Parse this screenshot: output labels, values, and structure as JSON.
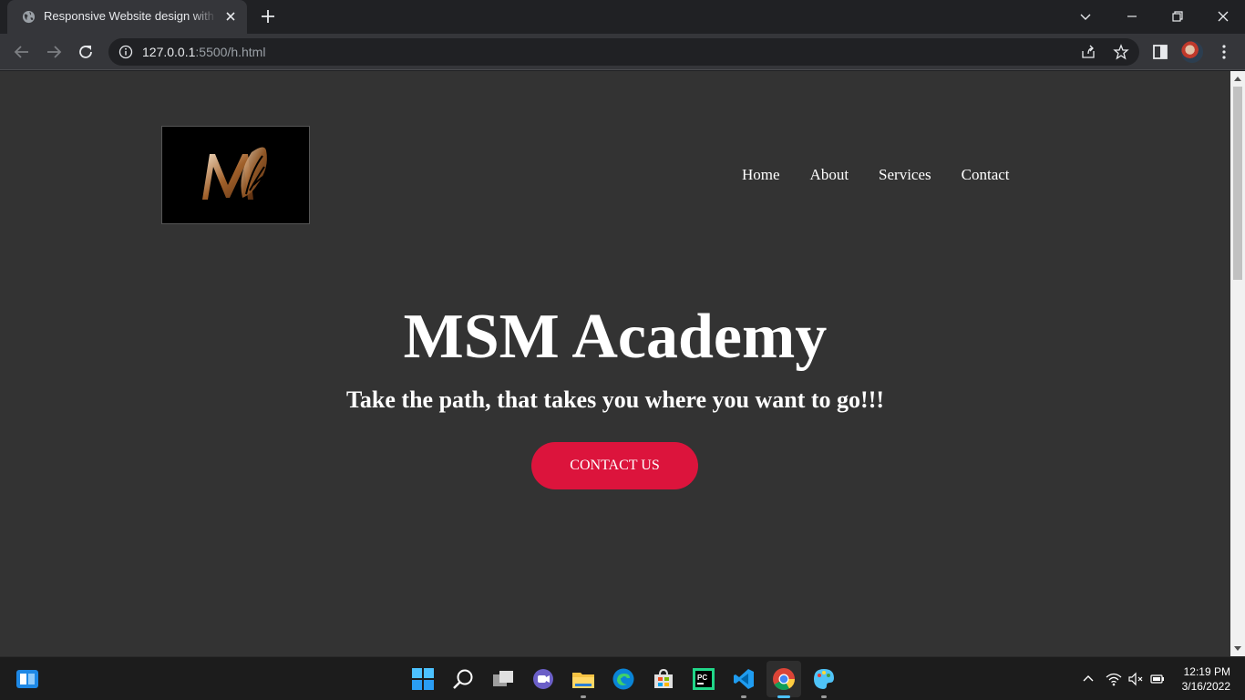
{
  "browser": {
    "tab_title": "Responsive Website design with HTML",
    "url_host": "127.0.0.1",
    "url_rest": ":5500/h.html"
  },
  "site": {
    "nav": [
      "Home",
      "About",
      "Services",
      "Contact"
    ],
    "hero_title": "MSM Academy",
    "hero_subtitle": "Take the path, that takes you where you want to go!!!",
    "cta_label": "CONTACT US",
    "accent_color": "#dc143c",
    "background_color": "#333333"
  },
  "taskbar": {
    "icons": [
      "widgets-icon",
      "start-icon",
      "search-icon",
      "task-view-icon",
      "chat-icon",
      "file-explorer-icon",
      "edge-icon",
      "store-icon",
      "pycharm-icon",
      "vscode-icon",
      "chrome-icon",
      "paint-icon"
    ],
    "time": "12:19 PM",
    "date": "3/16/2022"
  }
}
